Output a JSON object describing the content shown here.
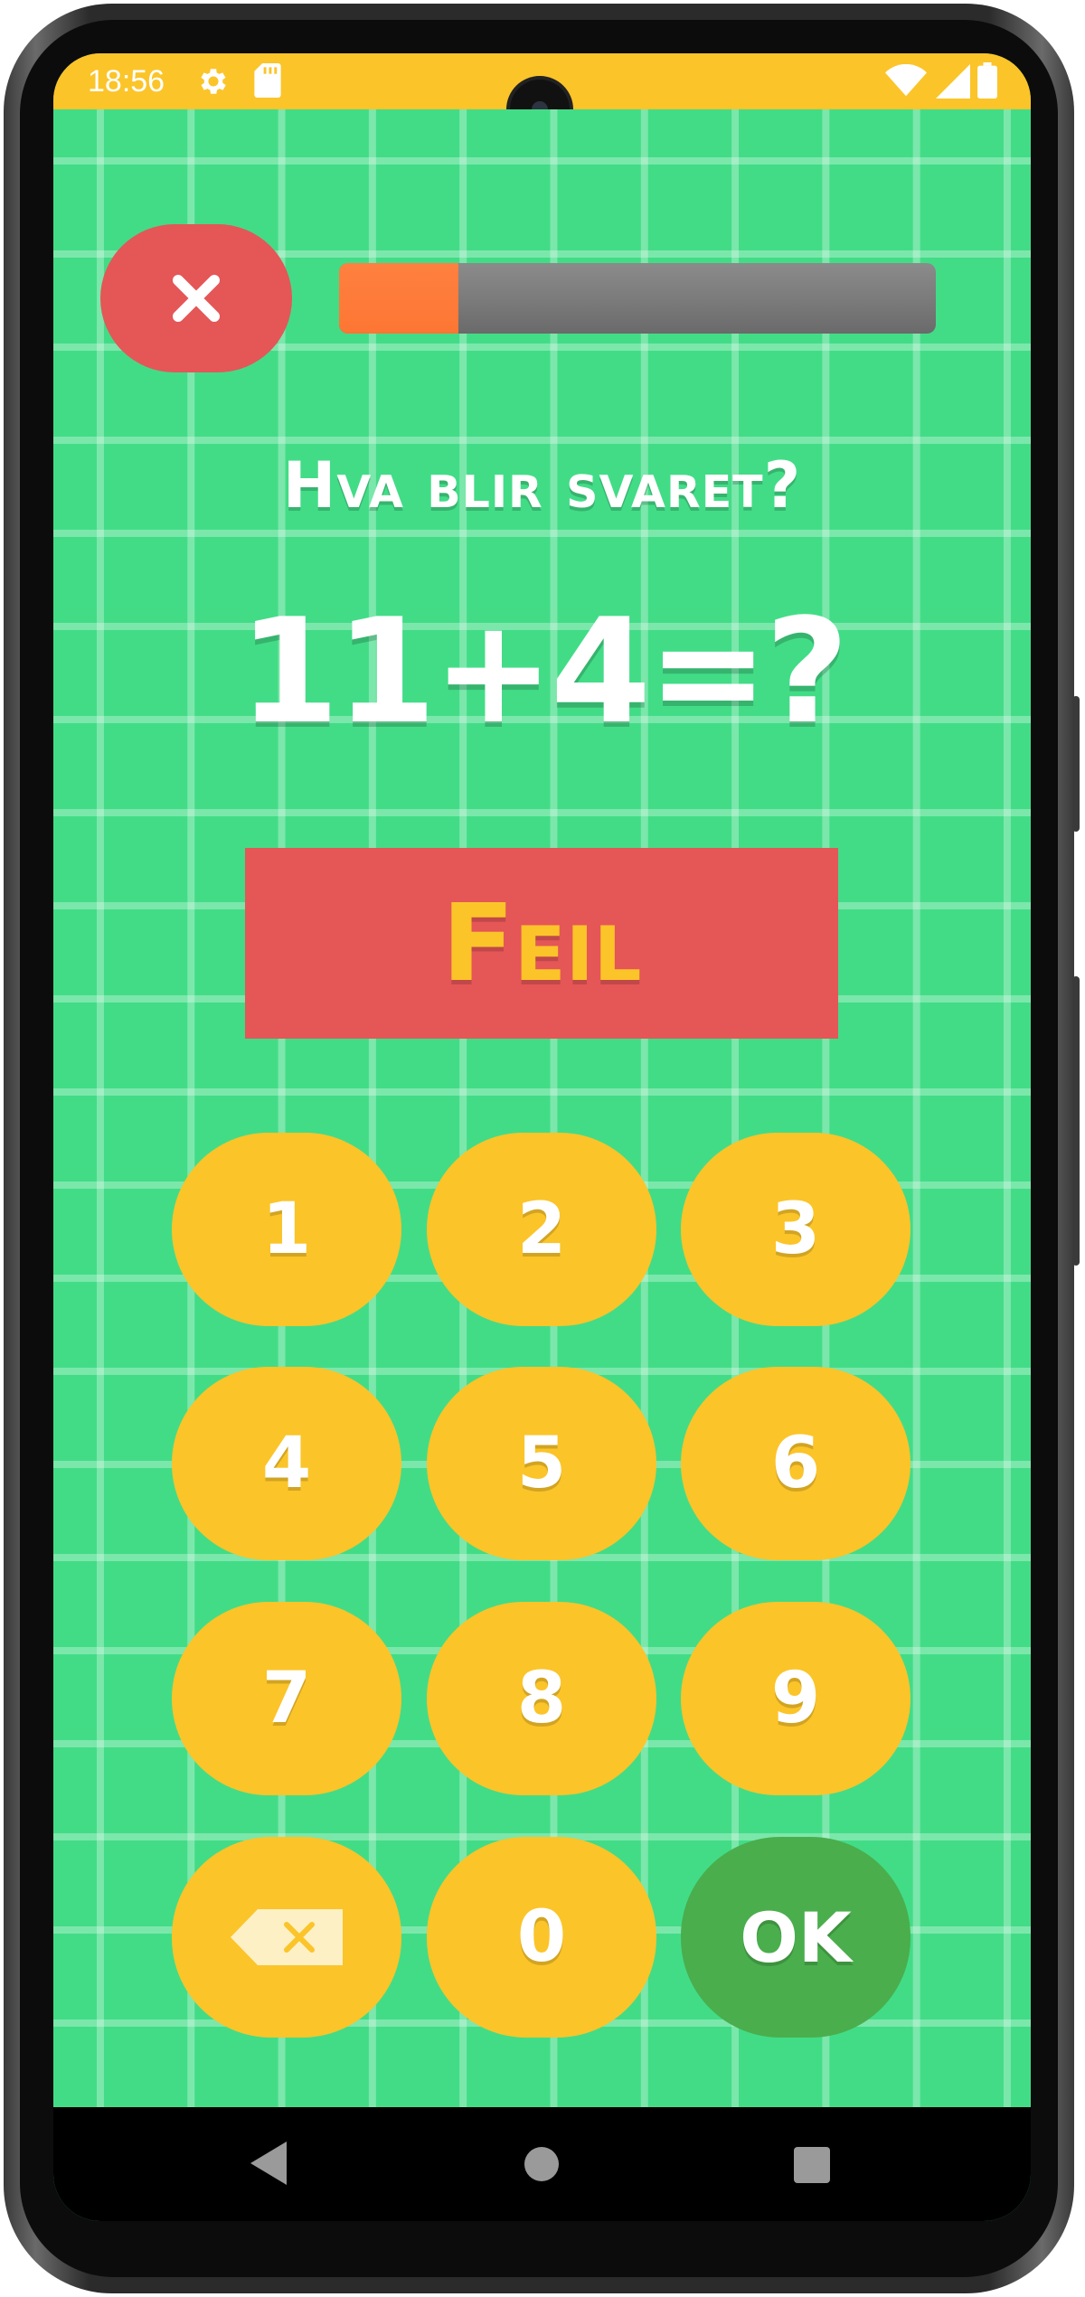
{
  "status_bar": {
    "time": "18:56",
    "icons": [
      "gear-icon",
      "sd-card-icon",
      "wifi-icon",
      "signal-icon",
      "battery-icon"
    ]
  },
  "game": {
    "close_icon": "close-icon",
    "progress_fraction": 0.2,
    "title": "Hva blir svaret?",
    "question": "11+4=?",
    "feedback": "Feil"
  },
  "keypad": {
    "keys": [
      "1",
      "2",
      "3",
      "4",
      "5",
      "6",
      "7",
      "8",
      "9",
      "0"
    ],
    "backspace_icon": "backspace-icon",
    "ok": "OK"
  },
  "nav_bar": {
    "icons": [
      "back-icon",
      "home-icon",
      "recents-icon"
    ]
  },
  "colors": {
    "background_green": "#42dc87",
    "accent_yellow": "#fbc429",
    "error_red": "#e55657",
    "progress_orange": "#fd7633",
    "ok_green": "#4aae4c"
  }
}
